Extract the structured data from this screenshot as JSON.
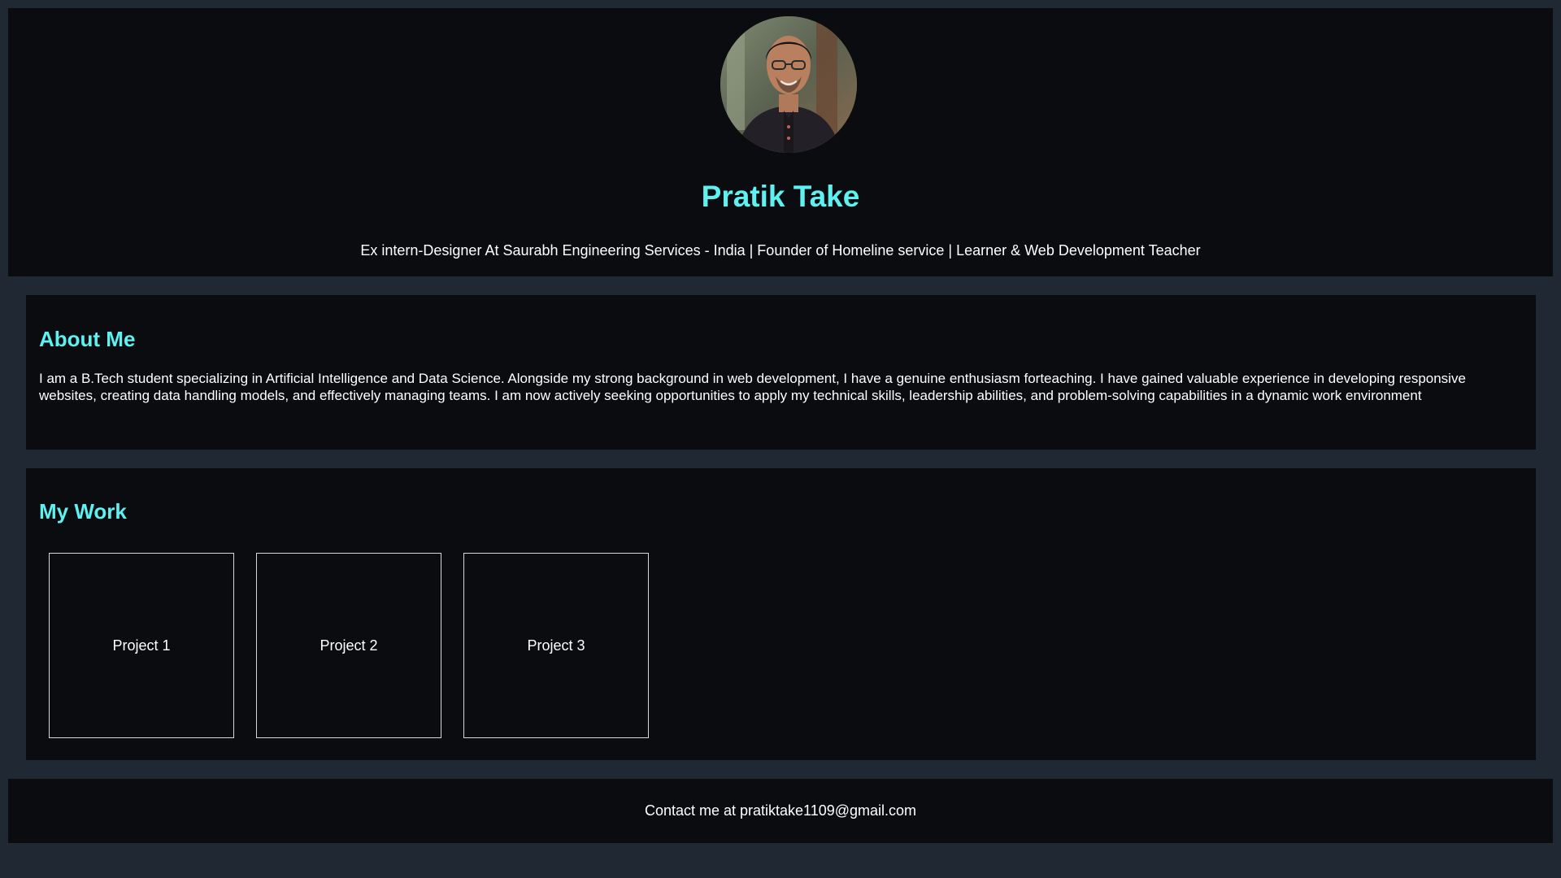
{
  "header": {
    "avatar_icon": "profile-photo",
    "name": "Pratik Take",
    "tagline": "Ex intern-Designer At Saurabh Engineering Services - India | Founder of Homeline service | Learner & Web Development Teacher"
  },
  "about": {
    "heading": "About Me",
    "text": "I am a B.Tech student specializing in Artificial Intelligence and Data Science. Alongside my strong background in web development, I have a genuine enthusiasm forteaching. I have gained valuable experience in developing responsive websites, creating data handling models, and effectively managing teams. I am now actively seeking opportunities to apply my technical skills, leadership abilities, and problem-solving capabilities in a dynamic work environment"
  },
  "work": {
    "heading": "My Work",
    "projects": [
      {
        "label": "Project 1"
      },
      {
        "label": "Project 2"
      },
      {
        "label": "Project 3"
      }
    ]
  },
  "footer": {
    "contact": "Contact me at pratiktake1109@gmail.com"
  },
  "colors": {
    "page_background": "#202833",
    "panel_background": "#0a0c10",
    "accent": "#5ff0f0",
    "text": "#ffffff",
    "card_border": "#d8d8d8"
  }
}
